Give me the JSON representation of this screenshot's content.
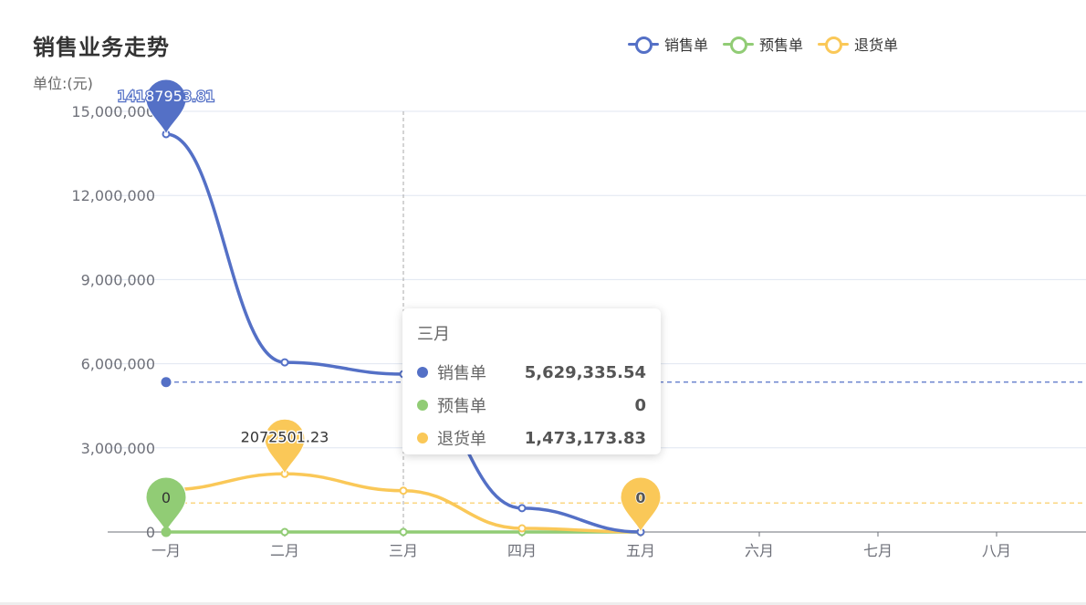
{
  "chart_data": {
    "type": "line",
    "title": "销售业务走势",
    "subtitle": "单位:(元)",
    "categories": [
      "一月",
      "二月",
      "三月",
      "四月",
      "五月",
      "六月",
      "七月",
      "八月"
    ],
    "ylim": [
      0,
      15000000
    ],
    "yticks": [
      0,
      3000000,
      6000000,
      9000000,
      12000000,
      15000000
    ],
    "ytick_labels": [
      "0",
      "3,000,000",
      "6,000,000",
      "9,000,000",
      "12,000,000",
      "15,000,000"
    ],
    "grid": true,
    "legend_position": "top-right",
    "series": [
      {
        "name": "销售单",
        "color": "#5470c6",
        "values": [
          14187953.81,
          6050000,
          5629335.54,
          850000,
          0
        ],
        "max_label": "14187953.81",
        "max_index": 0,
        "min_label": "0",
        "min_index": 4,
        "average": 5343457.87
      },
      {
        "name": "预售单",
        "color": "#91cc75",
        "values": [
          0,
          0,
          0,
          0,
          0
        ],
        "min_label": "0",
        "min_index": 0
      },
      {
        "name": "退货单",
        "color": "#fac858",
        "values": [
          1500000,
          2072501.23,
          1473173.83,
          130000,
          0
        ],
        "max_label": "2072501.23",
        "max_index": 1,
        "min_label": "0",
        "min_index": 4,
        "average": 1035135.01
      }
    ],
    "axis_pointer_index": 2
  },
  "tooltip": {
    "title": "三月",
    "rows": [
      {
        "name": "销售单",
        "value": "5,629,335.54",
        "color": "#5470c6"
      },
      {
        "name": "预售单",
        "value": "0",
        "color": "#91cc75"
      },
      {
        "name": "退货单",
        "value": "1,473,173.83",
        "color": "#fac858"
      }
    ]
  }
}
